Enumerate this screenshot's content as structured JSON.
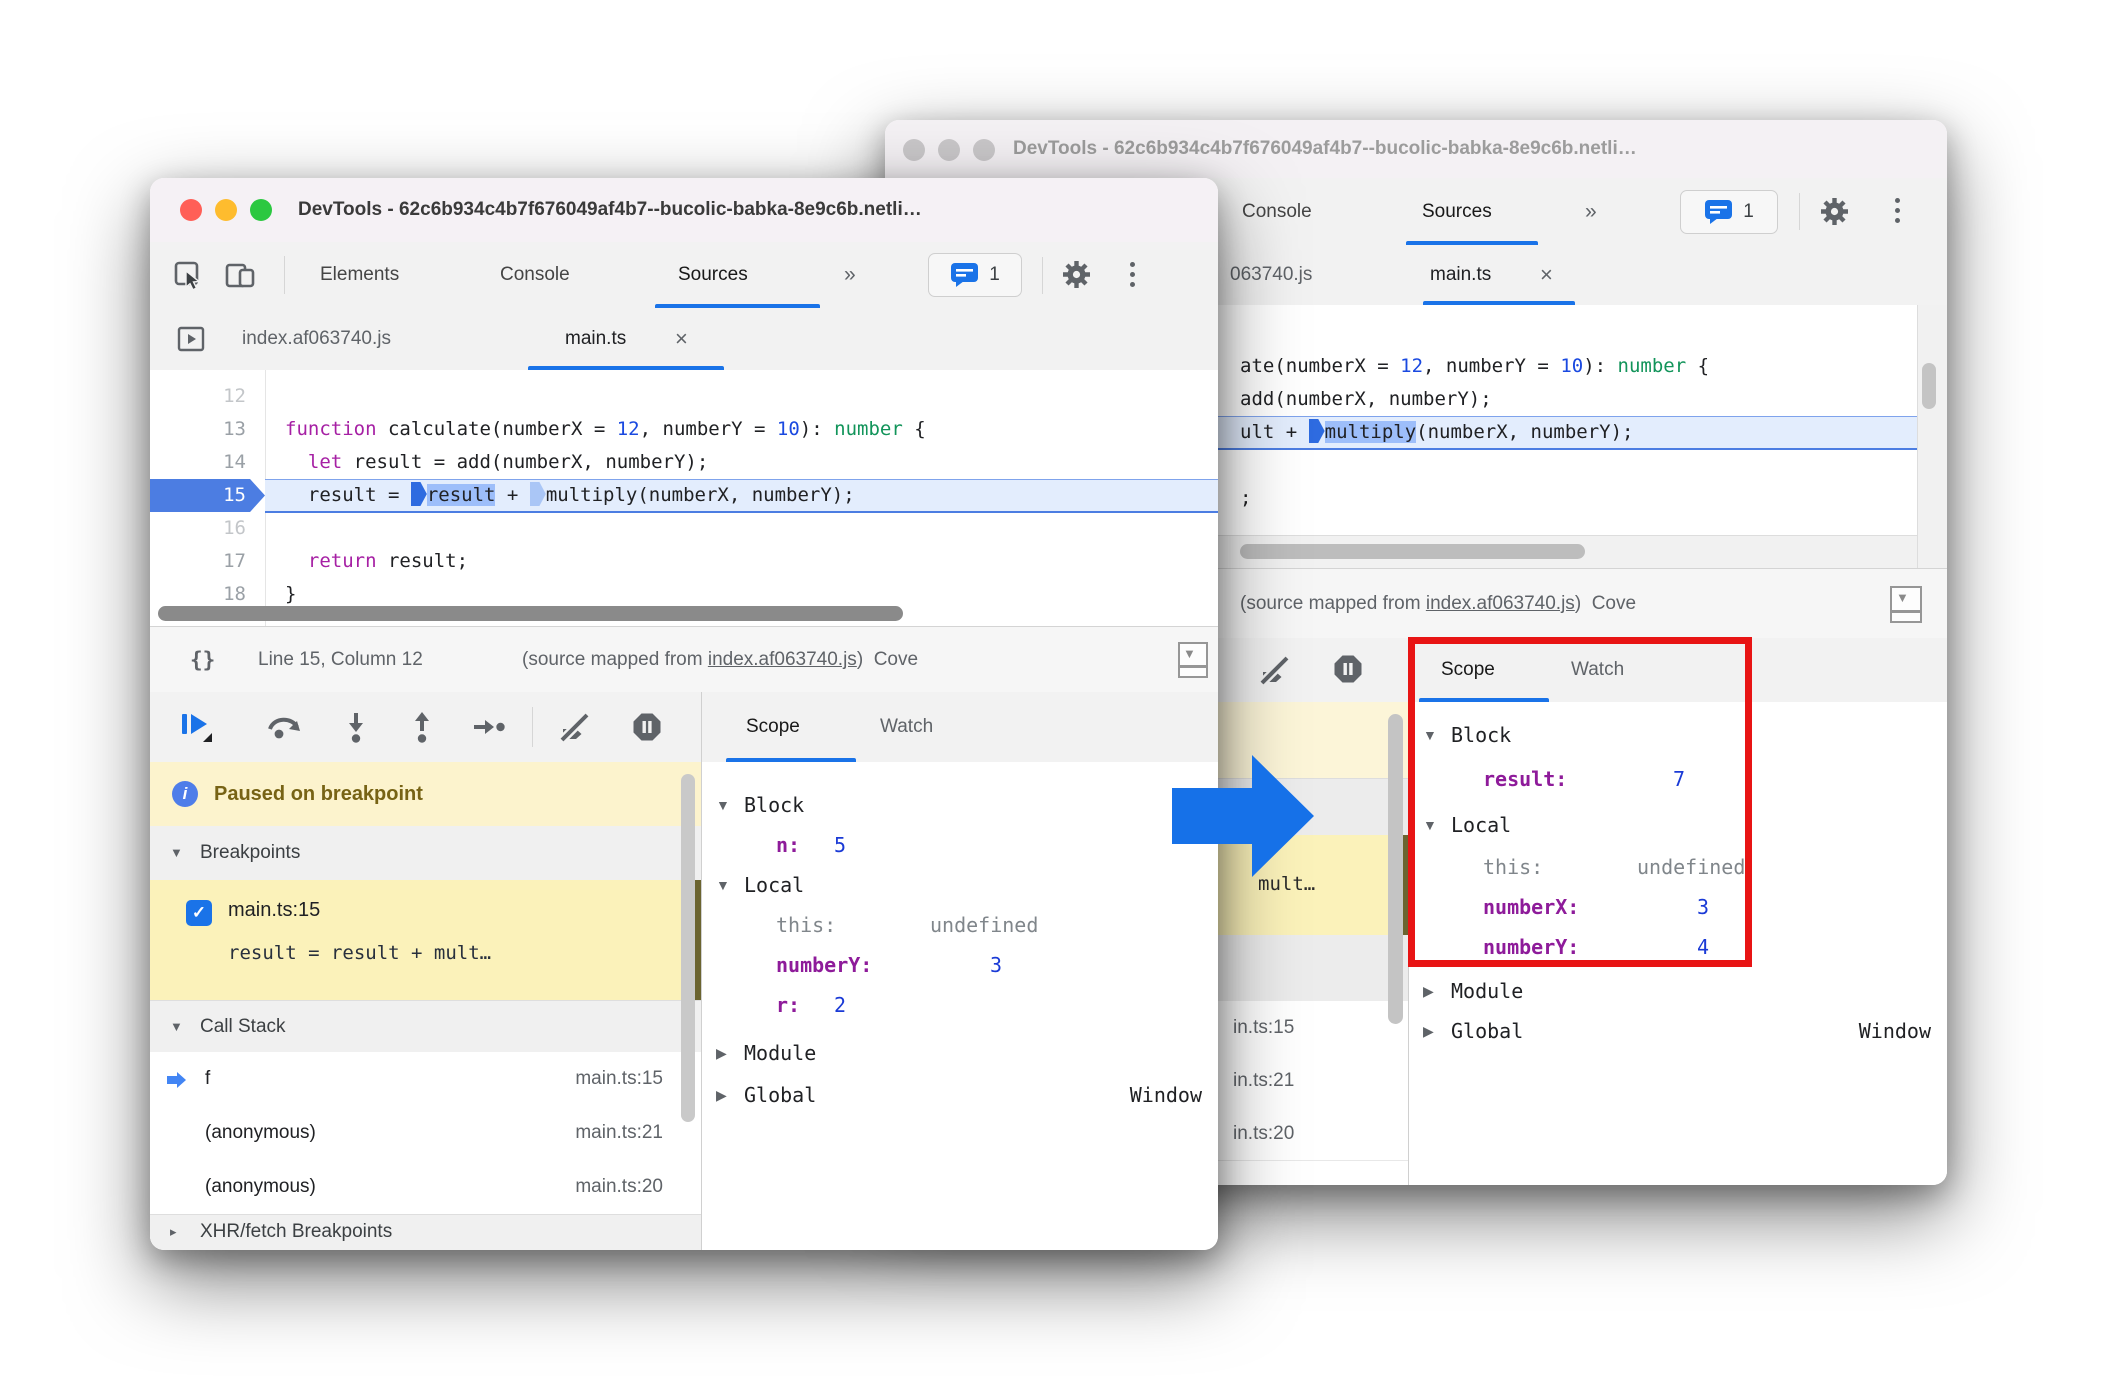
{
  "glyphs": {
    "expanded": "▼",
    "collapsed": "▶",
    "collapsed_small": "▸",
    "close": "×",
    "overflow": "»",
    "check": "✓",
    "braces": "{}",
    "caret_down": "▼",
    "info": "i"
  },
  "colors": {
    "accent": "#1a73e8",
    "red_box": "#e81414",
    "arrow_blue": "#1671e8",
    "keyword": "#a620a4",
    "number_token": "#1a49e0",
    "type_token": "#12945a",
    "property": "#8e1b9a",
    "paused_bg": "#fcf3cd"
  },
  "front_window": {
    "title": "DevTools - 62c6b934c4b7f676049af4b7--bucolic-babka-8e9c6b.netli…",
    "toolbar": {
      "tabs": [
        "Elements",
        "Console",
        "Sources"
      ],
      "overflow": "»",
      "badge_count": "1"
    },
    "file_tabs": {
      "inactive": "index.af063740.js",
      "active": "main.ts"
    },
    "editor": {
      "line_numbers": [
        "12",
        "13",
        "14",
        "15",
        "16",
        "17",
        "18"
      ],
      "l13": [
        "function",
        " calculate(numberX = ",
        "12",
        ", numberY = ",
        "10",
        "): ",
        "number",
        " {"
      ],
      "l14": [
        "  ",
        "let",
        " result = add(numberX, numberY);"
      ],
      "l15": {
        "pre": "  result = ",
        "sel": "result",
        "mid": " + ",
        "post": "multiply(numberX, numberY);"
      },
      "l17": [
        "  ",
        "return",
        " result;"
      ],
      "l18": "}"
    },
    "status": {
      "position": "Line 15, Column 12",
      "mapped_prefix": "(source mapped from ",
      "mapped_link": "index.af063740.js",
      "mapped_suffix": ")",
      "coverage": "Cove"
    },
    "debugger": {
      "paused": "Paused on breakpoint",
      "breakpoints_header": "Breakpoints",
      "bp_label": "main.ts:15",
      "bp_snippet": "result = result + mult…",
      "callstack_header": "Call Stack",
      "frames": [
        {
          "name": "f",
          "loc": "main.ts:15"
        },
        {
          "name": "(anonymous)",
          "loc": "main.ts:21"
        },
        {
          "name": "(anonymous)",
          "loc": "main.ts:20"
        }
      ],
      "xhr_header": "XHR/fetch Breakpoints"
    },
    "scope": {
      "tab_scope": "Scope",
      "tab_watch": "Watch",
      "sections": {
        "block": "Block",
        "local": "Local",
        "module": "Module",
        "global": "Global"
      },
      "vars": {
        "n": {
          "name": "n:",
          "value": "5"
        },
        "this": {
          "name": "this:",
          "value": "undefined"
        },
        "numberY": {
          "name": "numberY:",
          "value": "3"
        },
        "r": {
          "name": "r:",
          "value": "2"
        }
      },
      "global_value": "Window"
    }
  },
  "back_window": {
    "title": "DevTools - 62c6b934c4b7f676049af4b7--bucolic-babka-8e9c6b.netli…",
    "toolbar": {
      "tabs": [
        "Console",
        "Sources"
      ],
      "overflow": "»",
      "badge_count": "1"
    },
    "file_tabs": {
      "inactive": "063740.js",
      "active": "main.ts"
    },
    "editor": {
      "l1": [
        "ate(numberX = ",
        "12",
        ", numberY = ",
        "10",
        "): ",
        "number",
        " {"
      ],
      "l2": "add(numberX, numberY);",
      "l3": {
        "pre": "ult + ",
        "sel": "multiply",
        "post": "(numberX, numberY);"
      },
      "l5": ";"
    },
    "status": {
      "mapped_prefix": "(source mapped from ",
      "mapped_link": "index.af063740.js",
      "mapped_suffix": ")",
      "coverage": "Cove"
    },
    "sidebar": {
      "bp_snippet": "mult…",
      "frames": [
        "in.ts:15",
        "in.ts:21",
        "in.ts:20"
      ]
    },
    "scope": {
      "tab_scope": "Scope",
      "tab_watch": "Watch",
      "sections": {
        "block": "Block",
        "local": "Local",
        "module": "Module",
        "global": "Global"
      },
      "vars": {
        "result": {
          "name": "result:",
          "value": "7"
        },
        "this": {
          "name": "this:",
          "value": "undefined"
        },
        "numberX": {
          "name": "numberX:",
          "value": "3"
        },
        "numberY": {
          "name": "numberY:",
          "value": "4"
        }
      },
      "global_value": "Window"
    }
  }
}
